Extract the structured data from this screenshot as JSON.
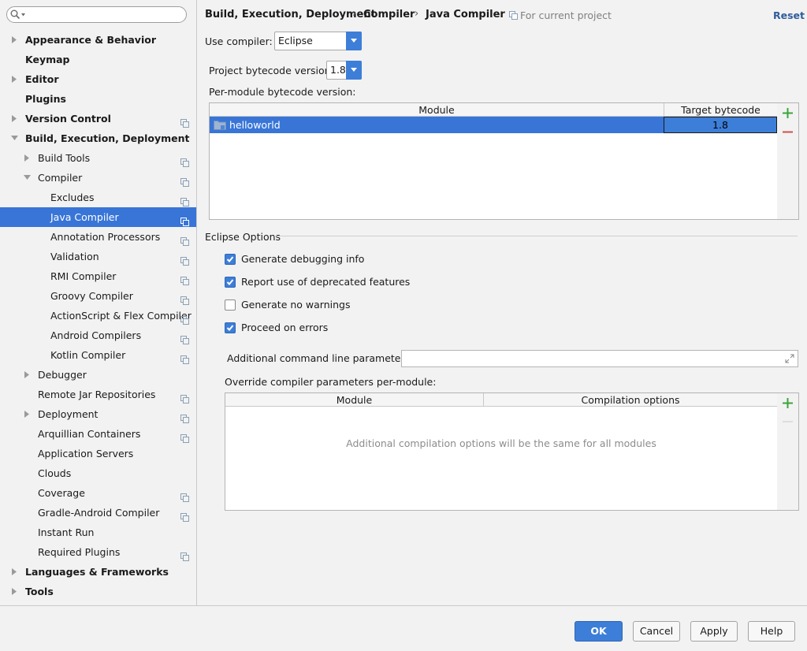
{
  "sidebar": {
    "search": {
      "value": "",
      "placeholder": ""
    },
    "items": [
      {
        "label": "Appearance & Behavior",
        "level": 0,
        "arrow": "collapsed",
        "bold": true,
        "project_icon": false,
        "selected": false
      },
      {
        "label": "Keymap",
        "level": 0,
        "arrow": "none",
        "bold": true,
        "project_icon": false,
        "selected": false
      },
      {
        "label": "Editor",
        "level": 0,
        "arrow": "collapsed",
        "bold": true,
        "project_icon": false,
        "selected": false
      },
      {
        "label": "Plugins",
        "level": 0,
        "arrow": "none",
        "bold": true,
        "project_icon": false,
        "selected": false
      },
      {
        "label": "Version Control",
        "level": 0,
        "arrow": "collapsed",
        "bold": true,
        "project_icon": true,
        "selected": false
      },
      {
        "label": "Build, Execution, Deployment",
        "level": 0,
        "arrow": "expanded",
        "bold": true,
        "project_icon": false,
        "selected": false
      },
      {
        "label": "Build Tools",
        "level": 1,
        "arrow": "collapsed",
        "bold": false,
        "project_icon": true,
        "selected": false
      },
      {
        "label": "Compiler",
        "level": 1,
        "arrow": "expanded",
        "bold": false,
        "project_icon": true,
        "selected": false
      },
      {
        "label": "Excludes",
        "level": 2,
        "arrow": "none",
        "bold": false,
        "project_icon": true,
        "selected": false
      },
      {
        "label": "Java Compiler",
        "level": 2,
        "arrow": "none",
        "bold": false,
        "project_icon": true,
        "selected": true
      },
      {
        "label": "Annotation Processors",
        "level": 2,
        "arrow": "none",
        "bold": false,
        "project_icon": true,
        "selected": false
      },
      {
        "label": "Validation",
        "level": 2,
        "arrow": "none",
        "bold": false,
        "project_icon": true,
        "selected": false
      },
      {
        "label": "RMI Compiler",
        "level": 2,
        "arrow": "none",
        "bold": false,
        "project_icon": true,
        "selected": false
      },
      {
        "label": "Groovy Compiler",
        "level": 2,
        "arrow": "none",
        "bold": false,
        "project_icon": true,
        "selected": false
      },
      {
        "label": "ActionScript & Flex Compiler",
        "level": 2,
        "arrow": "none",
        "bold": false,
        "project_icon": true,
        "selected": false
      },
      {
        "label": "Android Compilers",
        "level": 2,
        "arrow": "none",
        "bold": false,
        "project_icon": true,
        "selected": false
      },
      {
        "label": "Kotlin Compiler",
        "level": 2,
        "arrow": "none",
        "bold": false,
        "project_icon": true,
        "selected": false
      },
      {
        "label": "Debugger",
        "level": 1,
        "arrow": "collapsed",
        "bold": false,
        "project_icon": false,
        "selected": false
      },
      {
        "label": "Remote Jar Repositories",
        "level": 1,
        "arrow": "none",
        "bold": false,
        "project_icon": true,
        "selected": false
      },
      {
        "label": "Deployment",
        "level": 1,
        "arrow": "collapsed",
        "bold": false,
        "project_icon": true,
        "selected": false
      },
      {
        "label": "Arquillian Containers",
        "level": 1,
        "arrow": "none",
        "bold": false,
        "project_icon": true,
        "selected": false
      },
      {
        "label": "Application Servers",
        "level": 1,
        "arrow": "none",
        "bold": false,
        "project_icon": false,
        "selected": false
      },
      {
        "label": "Clouds",
        "level": 1,
        "arrow": "none",
        "bold": false,
        "project_icon": false,
        "selected": false
      },
      {
        "label": "Coverage",
        "level": 1,
        "arrow": "none",
        "bold": false,
        "project_icon": true,
        "selected": false
      },
      {
        "label": "Gradle-Android Compiler",
        "level": 1,
        "arrow": "none",
        "bold": false,
        "project_icon": true,
        "selected": false
      },
      {
        "label": "Instant Run",
        "level": 1,
        "arrow": "none",
        "bold": false,
        "project_icon": false,
        "selected": false
      },
      {
        "label": "Required Plugins",
        "level": 1,
        "arrow": "none",
        "bold": false,
        "project_icon": true,
        "selected": false
      },
      {
        "label": "Languages & Frameworks",
        "level": 0,
        "arrow": "collapsed",
        "bold": true,
        "project_icon": false,
        "selected": false
      },
      {
        "label": "Tools",
        "level": 0,
        "arrow": "collapsed",
        "bold": true,
        "project_icon": false,
        "selected": false
      }
    ]
  },
  "header": {
    "crumbs": [
      "Build, Execution, Deployment",
      "Compiler",
      "Java Compiler"
    ],
    "separator": "›",
    "scope": "For current project",
    "reset": "Reset"
  },
  "compiler": {
    "use_label": "Use compiler:",
    "use_value": "Eclipse",
    "bytecode_label": "Project bytecode version:",
    "bytecode_value": "1.8",
    "per_module_label": "Per-module bytecode version:"
  },
  "module_table": {
    "columns": [
      "Module",
      "Target bytecode version"
    ],
    "rows": [
      {
        "module": "helloworld",
        "target": "1.8"
      }
    ],
    "add": "+",
    "remove": "−"
  },
  "eclipse": {
    "title": "Eclipse Options",
    "options": [
      {
        "label": "Generate debugging info",
        "checked": true
      },
      {
        "label": "Report use of deprecated features",
        "checked": true
      },
      {
        "label": "Generate no warnings",
        "checked": false
      },
      {
        "label": "Proceed on errors",
        "checked": true
      }
    ],
    "cmd_label": "Additional command line parameters:",
    "cmd_value": "",
    "override_label": "Override compiler parameters per-module:"
  },
  "override_table": {
    "columns": [
      "Module",
      "Compilation options"
    ],
    "empty_text": "Additional compilation options will be the same for all modules",
    "add": "+",
    "remove": "−"
  },
  "footer": {
    "ok": "OK",
    "cancel": "Cancel",
    "apply": "Apply",
    "help": "Help"
  },
  "colors": {
    "selection": "#3875d7",
    "accent": "#3d7ed8",
    "add": "#3aa53a",
    "remove": "#d24e4e",
    "link": "#2f5c9c"
  }
}
